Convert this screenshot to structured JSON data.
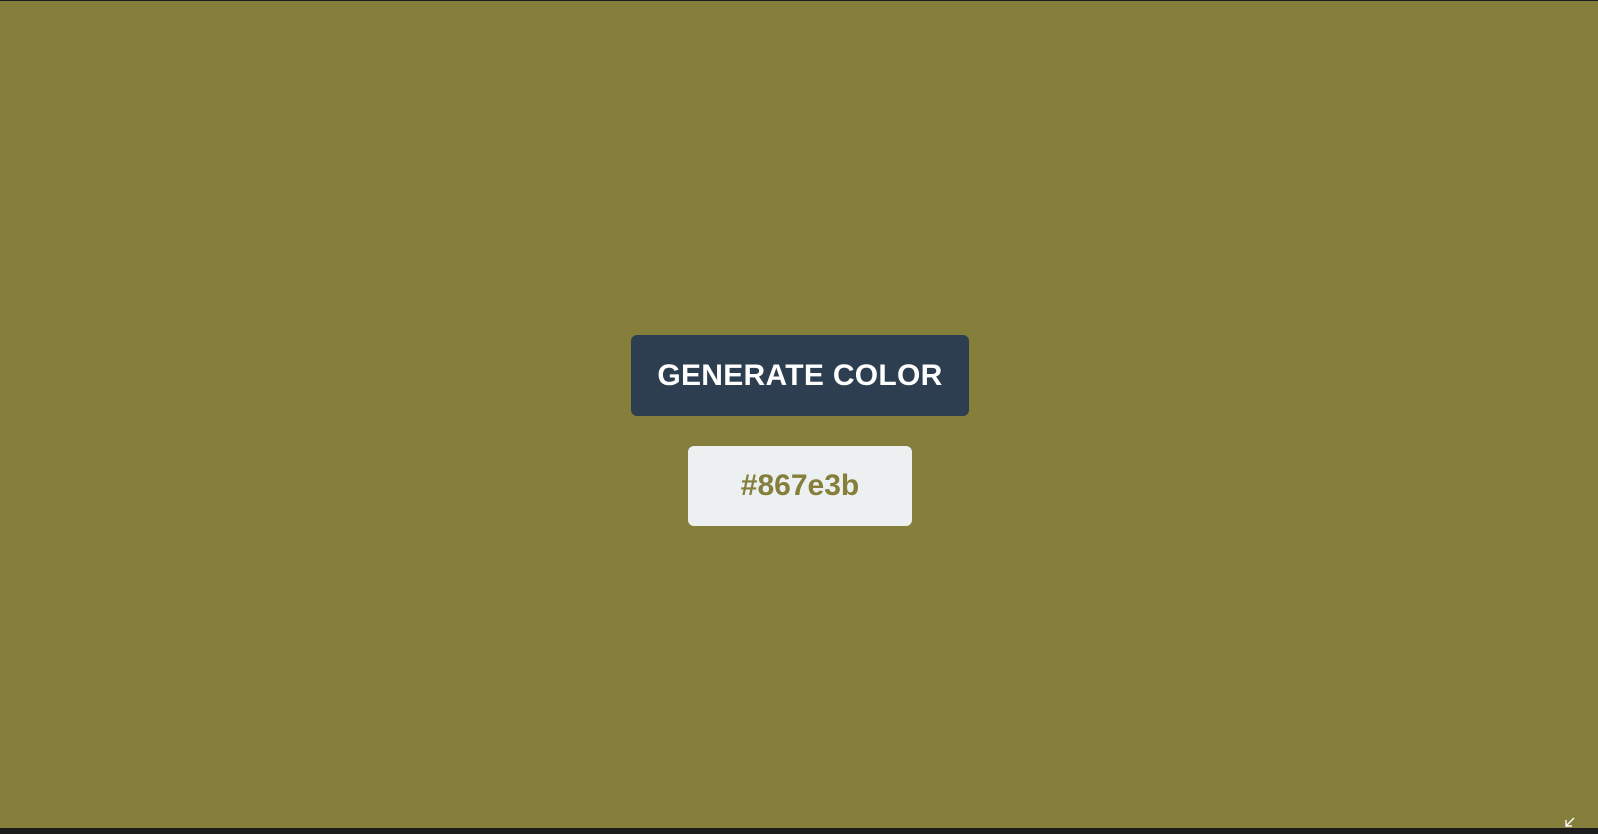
{
  "app": {
    "background_color": "#867e3b"
  },
  "generator": {
    "button_label": "GENERATE COLOR",
    "button_color": "#2c3e50",
    "current_color": "#867e3b",
    "code_box_color": "#ecf0f1"
  },
  "icons": {
    "corner": "resize-arrow-icon"
  }
}
